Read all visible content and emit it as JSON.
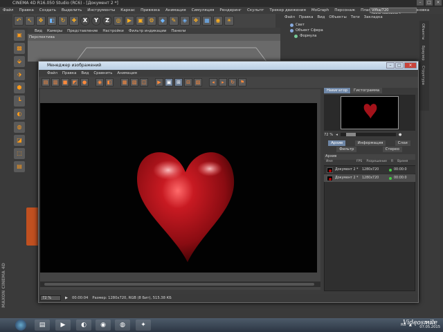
{
  "app": {
    "title": "CINEMA 4D R16.050 Studio (RC6) - [Документ 2 *]",
    "layout_select": "Vifka/720 (пользователь)",
    "menus": [
      "Файл",
      "Правка",
      "Создать",
      "Выделить",
      "Инструменты",
      "Каркас",
      "Привязка",
      "Анимация",
      "Симуляция",
      "Рендеринг",
      "Скульпт",
      "Трекер движения",
      "MoGraph",
      "Персонаж",
      "Плагины",
      "Скрипт",
      "Компоновка"
    ]
  },
  "viewport": {
    "menus": [
      "Вид",
      "Камеры",
      "Представление",
      "Настройки",
      "Фильтр индикации",
      "Панели"
    ],
    "label": "Перспектива"
  },
  "objects": {
    "menus": [
      "Файл",
      "Правка",
      "Вид",
      "Объекты",
      "Теги",
      "Закладка"
    ],
    "items": [
      "Свет",
      "Объект Сфера",
      "Формула"
    ]
  },
  "side_tabs": [
    "Объекты",
    "Браузер",
    "Структура"
  ],
  "maxon_label": "MAXON CINEMA 4D",
  "image_manager": {
    "title": "Менеджер изображений",
    "menus": [
      "Файл",
      "Правка",
      "Вид",
      "Сравнить",
      "Анимация"
    ],
    "status": {
      "zoom": "72 %",
      "time": "00:00:04",
      "info": "Размер: 1280x720, RGB (8 Бит), 515.38 КБ"
    },
    "navigator": {
      "tabs": [
        "Навигатор",
        "Гистограмма"
      ],
      "zoom": "72 %"
    },
    "info_tabs": {
      "row1": [
        "Архив",
        "Информация",
        "Слои"
      ],
      "row2": [
        "Фильтр",
        "Стерео"
      ]
    },
    "archive": {
      "heading": "Архив",
      "columns": [
        "Имя",
        "FPS",
        "Разрешение",
        "R",
        "Время"
      ],
      "rows": [
        {
          "name": "Документ 2 *",
          "resolution": "1280x720",
          "time": "00:00:0"
        },
        {
          "name": "Документ 2 *",
          "resolution": "1280x720",
          "time": "00:00:0"
        }
      ]
    }
  },
  "taskbar": {
    "lang": "RU",
    "time": "14:17",
    "date": "07.05.2015",
    "watermark": "Videosmile"
  },
  "colors": {
    "heart": "#b5121b",
    "title_bar": "#c9d9ea",
    "active_tab": "#6e86a6"
  }
}
